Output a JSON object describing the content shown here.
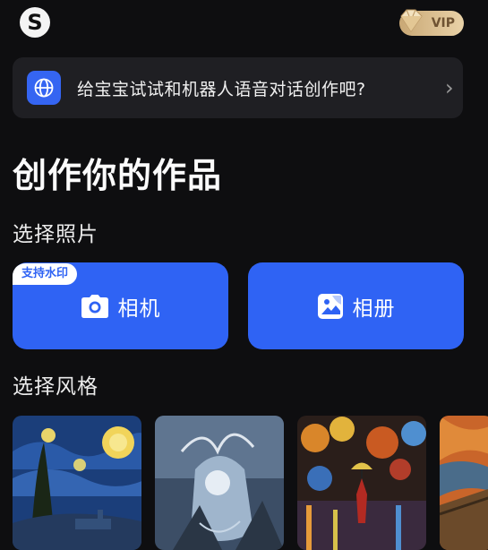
{
  "header": {
    "logo_letter": "S",
    "vip_label": "VIP"
  },
  "banner": {
    "text": "给宝宝试试和机器人语音对话创作吧?",
    "chevron": "›",
    "icon": "globe-icon"
  },
  "page_title": "创作你的作品",
  "photo_section": {
    "label": "选择照片",
    "camera_label": "相机",
    "album_label": "相册",
    "watermark_badge": "支持水印"
  },
  "style_section": {
    "label": "选择风格",
    "styles": [
      "starry-night-style",
      "fantasy-creature-style",
      "umbrella-painting-style",
      "scream-style"
    ]
  },
  "colors": {
    "accent": "#2f63f4",
    "background": "#0e0e10",
    "card": "#1f1f23",
    "vip_gold": "#d8bb8a"
  }
}
